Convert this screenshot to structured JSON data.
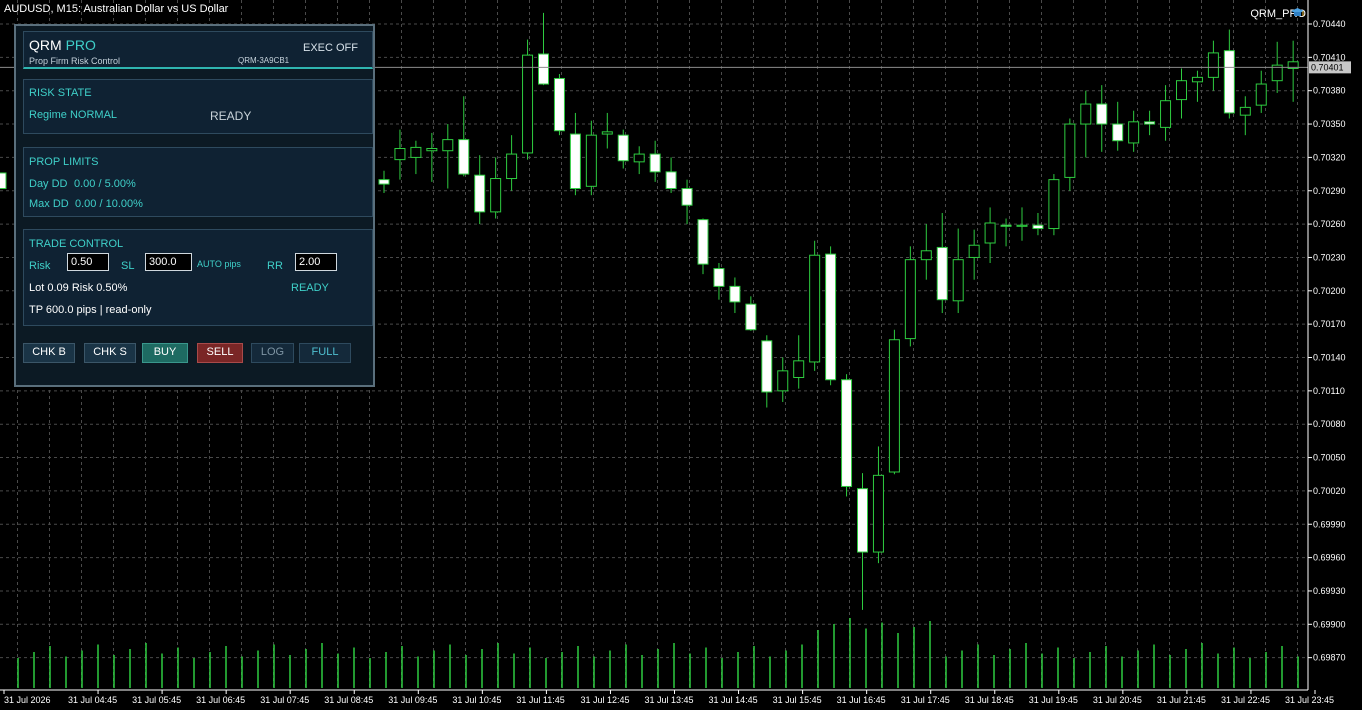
{
  "window": {
    "title": "AUDUSD, M15:  Australian Dollar vs US Dollar",
    "expert_name": "QRM_PRO"
  },
  "panel": {
    "brand_main": "QRM",
    "brand_accent": "PRO",
    "subtitle": "Prop Firm Risk Control",
    "account_id": "QRM-3A9CB1",
    "exec_status": "EXEC OFF",
    "risk_state": {
      "title": "RISK STATE",
      "regime": "Regime NORMAL",
      "status": "READY"
    },
    "prop_limits": {
      "title": "PROP LIMITS",
      "day_dd_label": "Day DD",
      "day_dd_value": "0.00 / 5.00%",
      "max_dd_label": "Max DD",
      "max_dd_value": "0.00 / 10.00%"
    },
    "trade_control": {
      "title": "TRADE CONTROL",
      "risk_label": "Risk",
      "risk_value": "0.50",
      "sl_label": "SL",
      "sl_value": "300.0",
      "auto_label": "AUTO pips",
      "rr_label": "RR",
      "rr_value": "2.00",
      "lot_text": "Lot 0.09   Risk 0.50%",
      "status": "READY",
      "tp_text": "TP 600.0 pips  |  read-only"
    },
    "buttons": {
      "chk_b": "CHK B",
      "chk_s": "CHK S",
      "buy": "BUY",
      "sell": "SELL",
      "log": "LOG",
      "full": "FULL"
    }
  },
  "colors": {
    "background": "#000000",
    "grid": "#4a4a4a",
    "bull_candle": "#000000",
    "bear_candle": "#ffffff",
    "wick": "#2ecc40",
    "volume": "#2ecc40",
    "accent": "#3fd0c9"
  },
  "chart_data": {
    "type": "candlestick",
    "symbol": "AUDUSD",
    "timeframe": "M15",
    "current_price": "0.70401",
    "ylim": [
      0.6986,
      0.7046
    ],
    "y_ticks": [
      "0.70440",
      "0.70410",
      "0.70380",
      "0.70350",
      "0.70320",
      "0.70290",
      "0.70260",
      "0.70230",
      "0.70200",
      "0.70170",
      "0.70140",
      "0.70110",
      "0.70080",
      "0.70050",
      "0.70020",
      "0.69990",
      "0.69960",
      "0.69930",
      "0.69900",
      "0.69870"
    ],
    "x_ticks": [
      "31 Jul 2026",
      "31 Jul 04:45",
      "31 Jul 05:45",
      "31 Jul 06:45",
      "31 Jul 07:45",
      "31 Jul 08:45",
      "31 Jul 09:45",
      "31 Jul 10:45",
      "31 Jul 11:45",
      "31 Jul 12:45",
      "31 Jul 13:45",
      "31 Jul 14:45",
      "31 Jul 15:45",
      "31 Jul 16:45",
      "31 Jul 17:45",
      "31 Jul 18:45",
      "31 Jul 19:45",
      "31 Jul 20:45",
      "31 Jul 21:45",
      "31 Jul 22:45",
      "31 Jul 23:45"
    ],
    "candles": [
      {
        "o": 0.703,
        "h": 0.70308,
        "l": 0.70288,
        "c": 0.70296
      },
      {
        "o": 0.70318,
        "h": 0.70345,
        "l": 0.703,
        "c": 0.70328
      },
      {
        "o": 0.7032,
        "h": 0.70335,
        "l": 0.70305,
        "c": 0.70329
      },
      {
        "o": 0.70326,
        "h": 0.70342,
        "l": 0.70298,
        "c": 0.70328
      },
      {
        "o": 0.70326,
        "h": 0.7035,
        "l": 0.70292,
        "c": 0.70336
      },
      {
        "o": 0.70336,
        "h": 0.70375,
        "l": 0.70303,
        "c": 0.70305
      },
      {
        "o": 0.70304,
        "h": 0.70322,
        "l": 0.7026,
        "c": 0.70271
      },
      {
        "o": 0.70271,
        "h": 0.7032,
        "l": 0.70265,
        "c": 0.70301
      },
      {
        "o": 0.70301,
        "h": 0.7034,
        "l": 0.7029,
        "c": 0.70323
      },
      {
        "o": 0.70324,
        "h": 0.70426,
        "l": 0.70318,
        "c": 0.70412
      },
      {
        "o": 0.70413,
        "h": 0.7045,
        "l": 0.70385,
        "c": 0.70386
      },
      {
        "o": 0.70391,
        "h": 0.70395,
        "l": 0.7034,
        "c": 0.70344
      },
      {
        "o": 0.70341,
        "h": 0.7036,
        "l": 0.70286,
        "c": 0.70292
      },
      {
        "o": 0.70294,
        "h": 0.70353,
        "l": 0.70286,
        "c": 0.7034
      },
      {
        "o": 0.70341,
        "h": 0.7036,
        "l": 0.70328,
        "c": 0.70343
      },
      {
        "o": 0.7034,
        "h": 0.70345,
        "l": 0.7031,
        "c": 0.70317
      },
      {
        "o": 0.70316,
        "h": 0.7033,
        "l": 0.70305,
        "c": 0.70323
      },
      {
        "o": 0.70323,
        "h": 0.70335,
        "l": 0.70298,
        "c": 0.70307
      },
      {
        "o": 0.70307,
        "h": 0.7032,
        "l": 0.70288,
        "c": 0.70292
      },
      {
        "o": 0.70292,
        "h": 0.703,
        "l": 0.7026,
        "c": 0.70277
      },
      {
        "o": 0.70264,
        "h": 0.70265,
        "l": 0.70215,
        "c": 0.70224
      },
      {
        "o": 0.7022,
        "h": 0.70225,
        "l": 0.70192,
        "c": 0.70204
      },
      {
        "o": 0.70204,
        "h": 0.70212,
        "l": 0.7018,
        "c": 0.7019
      },
      {
        "o": 0.70188,
        "h": 0.70195,
        "l": 0.70164,
        "c": 0.70165
      },
      {
        "o": 0.70155,
        "h": 0.7016,
        "l": 0.70095,
        "c": 0.70109
      },
      {
        "o": 0.7011,
        "h": 0.7014,
        "l": 0.701,
        "c": 0.70128
      },
      {
        "o": 0.70122,
        "h": 0.7016,
        "l": 0.70112,
        "c": 0.70137
      },
      {
        "o": 0.70136,
        "h": 0.70245,
        "l": 0.70128,
        "c": 0.70232
      },
      {
        "o": 0.70233,
        "h": 0.7024,
        "l": 0.70115,
        "c": 0.7012
      },
      {
        "o": 0.7012,
        "h": 0.70125,
        "l": 0.70015,
        "c": 0.70024
      },
      {
        "o": 0.70022,
        "h": 0.70036,
        "l": 0.69913,
        "c": 0.69965
      },
      {
        "o": 0.69965,
        "h": 0.7006,
        "l": 0.69955,
        "c": 0.70034
      },
      {
        "o": 0.70037,
        "h": 0.70165,
        "l": 0.70035,
        "c": 0.70156
      },
      {
        "o": 0.70157,
        "h": 0.7024,
        "l": 0.7015,
        "c": 0.70228
      },
      {
        "o": 0.70228,
        "h": 0.7026,
        "l": 0.7021,
        "c": 0.70236
      },
      {
        "o": 0.70239,
        "h": 0.7027,
        "l": 0.7018,
        "c": 0.70192
      },
      {
        "o": 0.70191,
        "h": 0.70256,
        "l": 0.7018,
        "c": 0.70228
      },
      {
        "o": 0.7023,
        "h": 0.70255,
        "l": 0.7021,
        "c": 0.70241
      },
      {
        "o": 0.70243,
        "h": 0.70275,
        "l": 0.70225,
        "c": 0.70261
      },
      {
        "o": 0.70259,
        "h": 0.70265,
        "l": 0.7024,
        "c": 0.70258
      },
      {
        "o": 0.70258,
        "h": 0.70275,
        "l": 0.70245,
        "c": 0.70259
      },
      {
        "o": 0.70259,
        "h": 0.7027,
        "l": 0.7025,
        "c": 0.70256
      },
      {
        "o": 0.70256,
        "h": 0.70305,
        "l": 0.7025,
        "c": 0.703
      },
      {
        "o": 0.70302,
        "h": 0.70355,
        "l": 0.7029,
        "c": 0.7035
      },
      {
        "o": 0.7035,
        "h": 0.7038,
        "l": 0.7032,
        "c": 0.70368
      },
      {
        "o": 0.70368,
        "h": 0.70385,
        "l": 0.70325,
        "c": 0.7035
      },
      {
        "o": 0.7035,
        "h": 0.7037,
        "l": 0.70326,
        "c": 0.70335
      },
      {
        "o": 0.70333,
        "h": 0.70362,
        "l": 0.70325,
        "c": 0.70352
      },
      {
        "o": 0.70352,
        "h": 0.70362,
        "l": 0.7034,
        "c": 0.7035
      },
      {
        "o": 0.70347,
        "h": 0.70385,
        "l": 0.70335,
        "c": 0.70371
      },
      {
        "o": 0.70372,
        "h": 0.704,
        "l": 0.70355,
        "c": 0.70389
      },
      {
        "o": 0.70388,
        "h": 0.70398,
        "l": 0.7037,
        "c": 0.70392
      },
      {
        "o": 0.70392,
        "h": 0.70425,
        "l": 0.7038,
        "c": 0.70414
      },
      {
        "o": 0.70416,
        "h": 0.70435,
        "l": 0.70355,
        "c": 0.7036
      },
      {
        "o": 0.70358,
        "h": 0.70375,
        "l": 0.7034,
        "c": 0.70365
      },
      {
        "o": 0.70367,
        "h": 0.70398,
        "l": 0.7036,
        "c": 0.70386
      },
      {
        "o": 0.70389,
        "h": 0.70424,
        "l": 0.70378,
        "c": 0.70403
      },
      {
        "o": 0.704,
        "h": 0.70425,
        "l": 0.7037,
        "c": 0.70406
      }
    ],
    "volumes": [
      8,
      8,
      8,
      8,
      8,
      8,
      8,
      8,
      8,
      8,
      8,
      8,
      8,
      8,
      8,
      8,
      8,
      8,
      8,
      8,
      8,
      8,
      8,
      8,
      8,
      8,
      8,
      8,
      8,
      8,
      8,
      8,
      8,
      8,
      8,
      8,
      8,
      8,
      8,
      8,
      8,
      8,
      8,
      8,
      8,
      8,
      8,
      8,
      8,
      8,
      8,
      8,
      8,
      8,
      8,
      8,
      8,
      8,
      8,
      8,
      8,
      8,
      8,
      8,
      8,
      8,
      8,
      8,
      8,
      8,
      8,
      8,
      8,
      8,
      8,
      8,
      8,
      8,
      8,
      8,
      8,
      8
    ]
  }
}
